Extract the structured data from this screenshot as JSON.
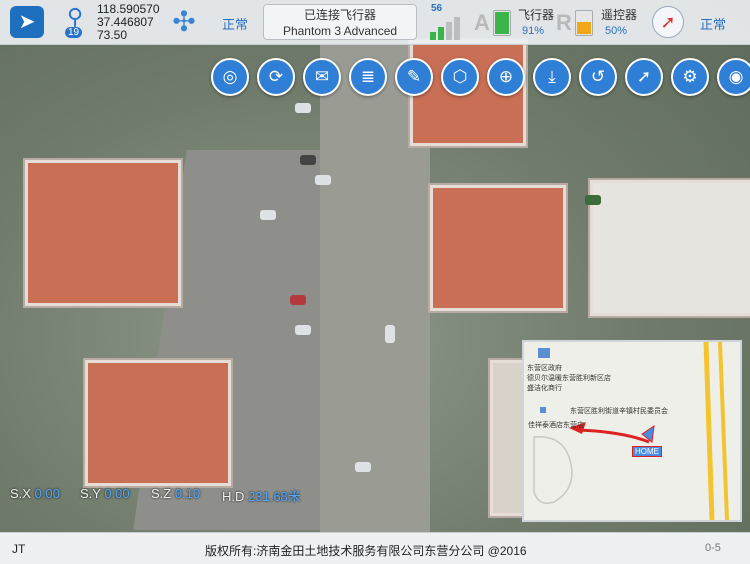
{
  "topbar": {
    "satellite_count": "19",
    "longitude": "118.590570",
    "latitude": "37.446807",
    "altitude": "73.50",
    "drone_status": "正常",
    "connection_status": "已连接飞行器",
    "aircraft_model": "Phantom 3 Advanced",
    "signal_label": "56",
    "aircraft_battery": {
      "letter": "A",
      "label": "飞行器",
      "percent": "91%",
      "level": 0.91,
      "color": "#3bb54a"
    },
    "remote_battery": {
      "letter": "R",
      "label": "遥控器",
      "percent": "50%",
      "level": 0.5,
      "color": "#f0a818"
    },
    "compass_status": "正常"
  },
  "toolbar": [
    {
      "name": "location-button",
      "icon": "map-pin-icon",
      "glyph": "◎"
    },
    {
      "name": "refresh-button",
      "icon": "refresh-icon",
      "glyph": "⟳"
    },
    {
      "name": "chat-button",
      "icon": "chat-bubbles-icon",
      "glyph": "✉"
    },
    {
      "name": "layers-button",
      "icon": "layers-icon",
      "glyph": "≣"
    },
    {
      "name": "edit-button",
      "icon": "edit-icon",
      "glyph": "✎"
    },
    {
      "name": "waypoint-button",
      "icon": "hexagon-icon",
      "glyph": "⬡"
    },
    {
      "name": "globe-button",
      "icon": "globe-icon",
      "glyph": "⊕"
    },
    {
      "name": "download-button",
      "icon": "download-icon",
      "glyph": "⤓"
    },
    {
      "name": "return-home-button",
      "icon": "return-home-icon",
      "glyph": "↺"
    },
    {
      "name": "compass-button",
      "icon": "compass-icon",
      "glyph": "➚"
    },
    {
      "name": "settings-button",
      "icon": "gear-icon",
      "glyph": "⚙"
    },
    {
      "name": "camera-button",
      "icon": "camera-icon",
      "glyph": "◉"
    }
  ],
  "telemetry": {
    "sx_label": "S.X",
    "sx_value": "0.00",
    "sy_label": "S.Y",
    "sy_value": "0.00",
    "sz_label": "S.Z",
    "sz_value": "0.10",
    "hd_label": "H.D",
    "hd_value": "231.68米"
  },
  "minimap": {
    "poi_1": "东营区政府",
    "poi_2": "德贝尔温暖东营胜利新区店",
    "poi_3": "盛洁化商行",
    "poi_4": "东营区胜利街道辛镇村民委员会",
    "poi_5": "佳祥泰酒店东营店",
    "home_label": "HOME",
    "road_color": "#f4c430"
  },
  "footer": {
    "left": "JT",
    "copyright": "版权所有:济南金田土地技术服务有限公司东营分公司  @2016",
    "right": "0-5"
  }
}
